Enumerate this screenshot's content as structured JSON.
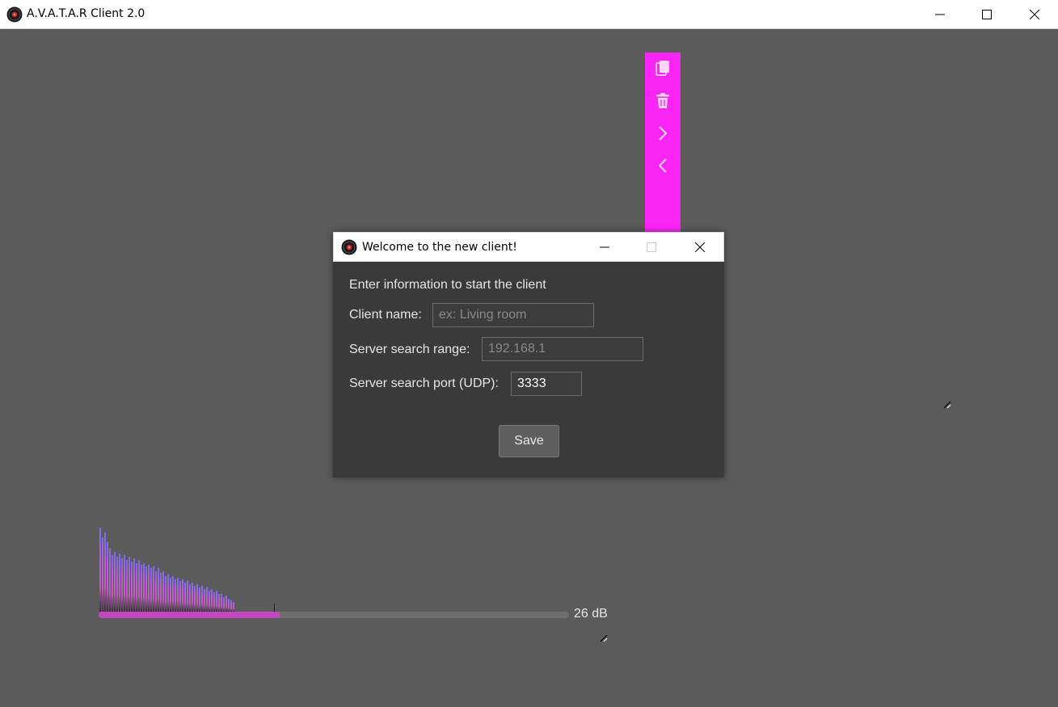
{
  "app": {
    "title": "A.V.A.T.A.R Client 2.0"
  },
  "window_controls": {
    "minimize": "minimize-icon",
    "maximize": "maximize-icon",
    "close": "close-icon"
  },
  "toolbar": {
    "color": "#fb25f6",
    "items": [
      {
        "name": "copy-icon"
      },
      {
        "name": "trash-icon"
      },
      {
        "name": "chevron-right-icon"
      },
      {
        "name": "chevron-left-icon"
      }
    ]
  },
  "dialog": {
    "title": "Welcome to the new client!",
    "heading": "Enter information to start the client",
    "client_name": {
      "label": "Client name:",
      "value": "",
      "placeholder": "ex: Living room"
    },
    "search_range": {
      "label": "Server search range:",
      "value": "",
      "placeholder": "192.168.1"
    },
    "search_port": {
      "label": "Server search port (UDP):",
      "value": "3333"
    },
    "save_label": "Save"
  },
  "meter": {
    "level_fraction": 0.385,
    "db_text": "26 dB",
    "accent": "#c348c0"
  }
}
